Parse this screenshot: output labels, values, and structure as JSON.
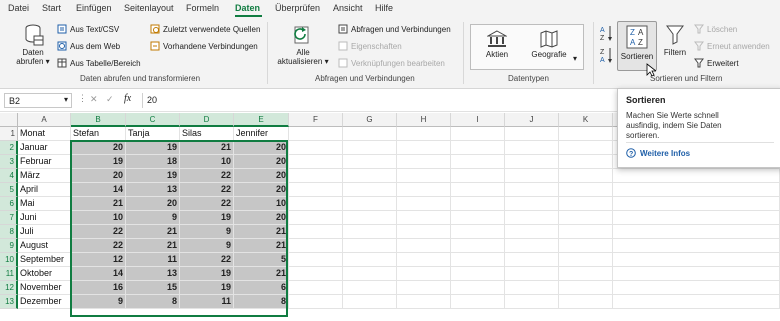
{
  "tabs": [
    "Datei",
    "Start",
    "Einfügen",
    "Seitenlayout",
    "Formeln",
    "Daten",
    "Überprüfen",
    "Ansicht",
    "Hilfe"
  ],
  "active_tab": "Daten",
  "ribbon": {
    "get_data": {
      "data_label": "Daten",
      "fetch_label": "abrufen",
      "from_text": "Aus Text/CSV",
      "from_web": "Aus dem Web",
      "from_table": "Aus Tabelle/Bereich",
      "recent_sources": "Zuletzt verwendete Quellen",
      "existing_connections": "Vorhandene Verbindungen",
      "group_label": "Daten abrufen und transformieren"
    },
    "queries": {
      "refresh_label1": "Alle",
      "refresh_label2": "aktualisieren",
      "queries_connections": "Abfragen und Verbindungen",
      "properties": "Eigenschaften",
      "edit_links": "Verknüpfungen bearbeiten",
      "group_label": "Abfragen und Verbindungen"
    },
    "datatypes": {
      "stocks": "Aktien",
      "geography": "Geografie",
      "group_label": "Datentypen"
    },
    "sort_filter": {
      "sort": "Sortieren",
      "filter": "Filtern",
      "clear": "Löschen",
      "reapply": "Erneut anwenden",
      "advanced": "Erweitert",
      "group_label": "Sortieren und Filtern"
    }
  },
  "formula_bar": {
    "name_box": "B2",
    "formula": "20",
    "cancel": "✕",
    "confirm": "✓",
    "fx": "fx"
  },
  "columns": [
    "A",
    "B",
    "C",
    "D",
    "E",
    "F",
    "G",
    "H",
    "I",
    "J",
    "K"
  ],
  "rows": [
    "1",
    "2",
    "3",
    "4",
    "5",
    "6",
    "7",
    "8",
    "9",
    "10",
    "11",
    "12",
    "13"
  ],
  "sheet": {
    "headers": [
      "Monat",
      "Stefan",
      "Tanja",
      "Silas",
      "Jennifer"
    ],
    "data": [
      [
        "Januar",
        "20",
        "19",
        "21",
        "20"
      ],
      [
        "Februar",
        "19",
        "18",
        "10",
        "20"
      ],
      [
        "März",
        "20",
        "19",
        "22",
        "20"
      ],
      [
        "April",
        "14",
        "13",
        "22",
        "20"
      ],
      [
        "Mai",
        "21",
        "20",
        "22",
        "10"
      ],
      [
        "Juni",
        "10",
        "9",
        "19",
        "20"
      ],
      [
        "Juli",
        "22",
        "21",
        "9",
        "21"
      ],
      [
        "August",
        "22",
        "21",
        "9",
        "21"
      ],
      [
        "September",
        "12",
        "11",
        "22",
        "5"
      ],
      [
        "Oktober",
        "14",
        "13",
        "19",
        "21"
      ],
      [
        "November",
        "16",
        "15",
        "19",
        "6"
      ],
      [
        "Dezember",
        "9",
        "8",
        "11",
        "8"
      ]
    ]
  },
  "tooltip": {
    "title": "Sortieren",
    "body1": "Machen Sie Werte schnell",
    "body2": "ausfindig, indem Sie Daten",
    "body3": "sortieren.",
    "link": "Weitere Infos"
  },
  "colors": {
    "accent": "#107c41",
    "selection_fill": "#c6c6c6",
    "link": "#1f5fa8"
  }
}
